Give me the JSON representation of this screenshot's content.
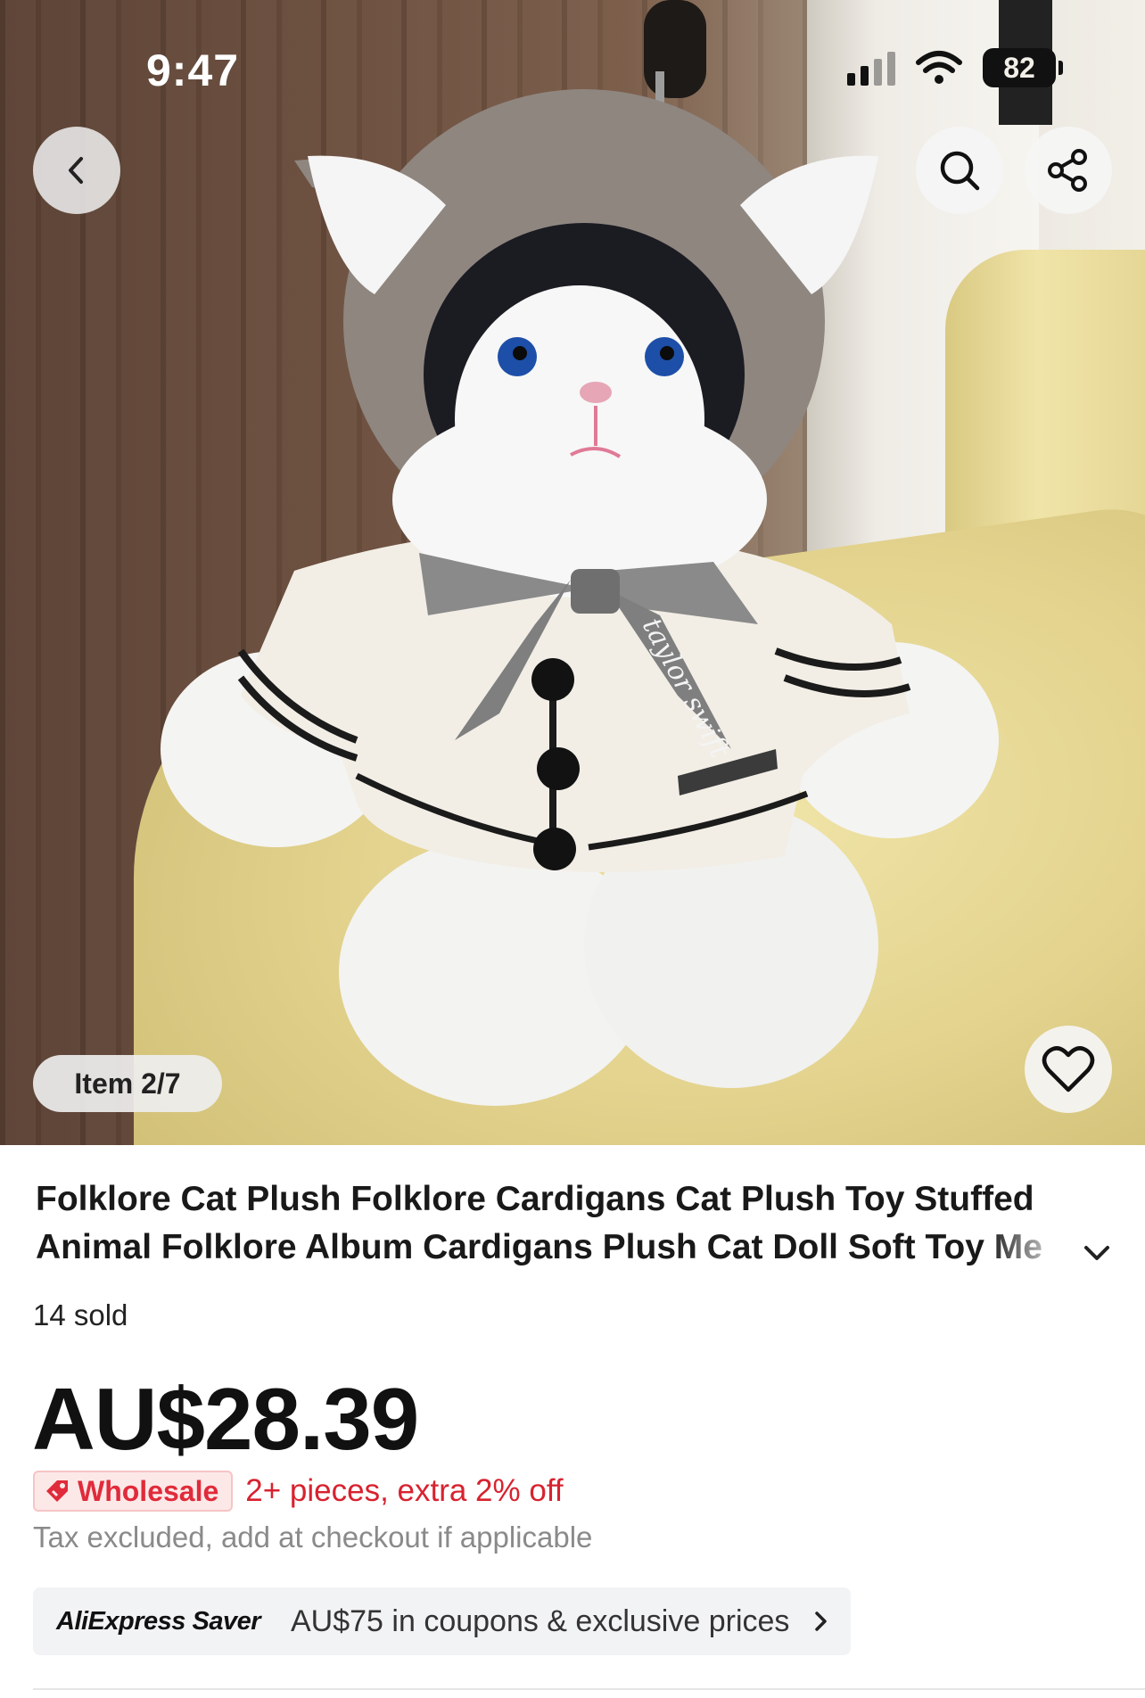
{
  "status_bar": {
    "time": "9:47",
    "battery": "82"
  },
  "gallery": {
    "counter": "Item 2/7",
    "product_text_on_image": "taylor swift"
  },
  "product": {
    "title_line1": "Folklore Cat Plush Folklore Cardigans Cat Plush Toy Stuffed",
    "title_line2": "Animal Folklore Album Cardigans Plush Cat Doll Soft Toy Me",
    "sold": "14 sold",
    "price": "AU$28.39",
    "wholesale_label": "Wholesale",
    "wholesale_offer": "2+ pieces, extra 2% off",
    "tax_note": "Tax excluded, add at checkout if applicable"
  },
  "saver": {
    "brand_a": "AliExpress",
    "brand_b": "Saver",
    "text": "AU$75 in coupons & exclusive prices"
  },
  "colors": {
    "accent_red": "#d8222f",
    "wholesale_bg": "#fde8e8",
    "price_text": "#111111"
  },
  "icons": [
    "back-icon",
    "search-icon",
    "share-icon",
    "heart-icon",
    "chevron-down-icon",
    "chevron-right-icon",
    "tag-icon"
  ]
}
